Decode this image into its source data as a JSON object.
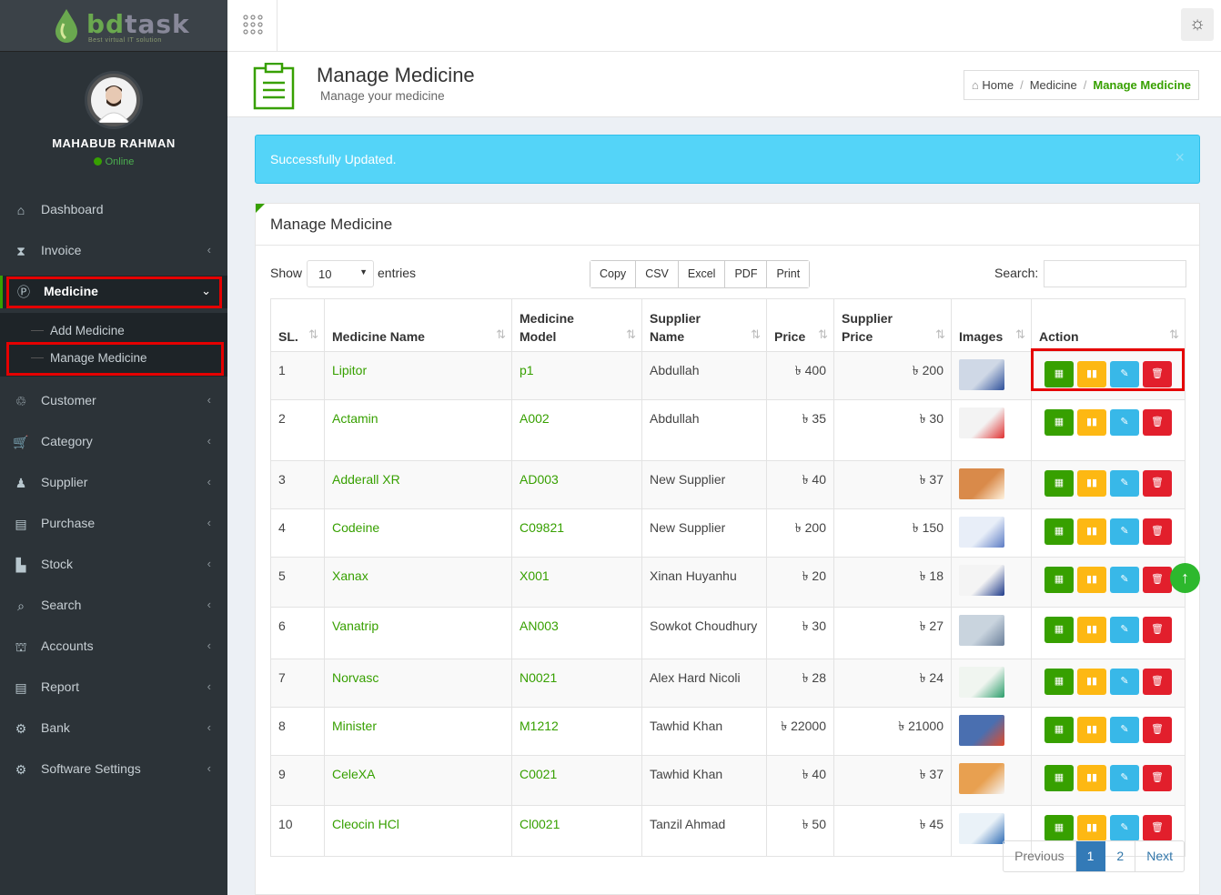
{
  "brand": {
    "name": "bd",
    "name2": "task",
    "tagline": "Best virtual IT solution"
  },
  "user": {
    "name": "MAHABUB RAHMAN",
    "status": "Online"
  },
  "sidebar": {
    "items": [
      {
        "label": "Dashboard",
        "icon": "home-icon",
        "chevron": ""
      },
      {
        "label": "Invoice",
        "icon": "hourglass-icon",
        "chevron": "‹"
      },
      {
        "label": "Medicine",
        "icon": "pill-icon",
        "chevron": "⌄"
      },
      {
        "label": "Customer",
        "icon": "handshake-icon",
        "chevron": "‹"
      },
      {
        "label": "Category",
        "icon": "cart-icon",
        "chevron": "‹"
      },
      {
        "label": "Supplier",
        "icon": "person-icon",
        "chevron": "‹"
      },
      {
        "label": "Purchase",
        "icon": "file-icon",
        "chevron": "‹"
      },
      {
        "label": "Stock",
        "icon": "bar-chart-icon",
        "chevron": "‹"
      },
      {
        "label": "Search",
        "icon": "search-icon",
        "chevron": "‹"
      },
      {
        "label": "Accounts",
        "icon": "bank-icon",
        "chevron": "‹"
      },
      {
        "label": "Report",
        "icon": "report-icon",
        "chevron": "‹"
      },
      {
        "label": "Bank",
        "icon": "gear-icon",
        "chevron": "‹"
      },
      {
        "label": "Software Settings",
        "icon": "gears-icon",
        "chevron": "‹"
      }
    ],
    "sub": [
      "Add Medicine",
      "Manage Medicine"
    ]
  },
  "header": {
    "title": "Manage Medicine",
    "subtitle": "Manage your medicine"
  },
  "breadcrumb": [
    "Home",
    "Medicine",
    "Manage Medicine"
  ],
  "alert": "Successfully Updated.",
  "panel": {
    "title": "Manage Medicine",
    "show": "Show",
    "entries": "entries",
    "page_size": "10",
    "search_label": "Search:",
    "buttons": [
      "Copy",
      "CSV",
      "Excel",
      "PDF",
      "Print"
    ]
  },
  "table": {
    "columns": [
      "SL.",
      "Medicine Name",
      "Medicine Model",
      "Supplier Name",
      "Price",
      "Supplier Price",
      "Images",
      "Action"
    ],
    "rows": [
      {
        "sl": "1",
        "name": "Lipitor",
        "model": "p1",
        "supplier": "Abdullah",
        "price": "৳ 400",
        "sprice": "৳ 200"
      },
      {
        "sl": "2",
        "name": "Actamin",
        "model": "A002",
        "supplier": "Abdullah",
        "price": "৳ 35",
        "sprice": "৳ 30"
      },
      {
        "sl": "3",
        "name": "Adderall XR",
        "model": "AD003",
        "supplier": "New Supplier",
        "price": "৳ 40",
        "sprice": "৳ 37"
      },
      {
        "sl": "4",
        "name": "Codeine",
        "model": "C09821",
        "supplier": "New Supplier",
        "price": "৳ 200",
        "sprice": "৳ 150"
      },
      {
        "sl": "5",
        "name": "Xanax",
        "model": "X001",
        "supplier": "Xinan Huyanhu",
        "price": "৳ 20",
        "sprice": "৳ 18"
      },
      {
        "sl": "6",
        "name": "Vanatrip",
        "model": "AN003",
        "supplier": "Sowkot Choudhury",
        "price": "৳ 30",
        "sprice": "৳ 27"
      },
      {
        "sl": "7",
        "name": "Norvasc",
        "model": "N0021",
        "supplier": "Alex Hard Nicoli",
        "price": "৳ 28",
        "sprice": "৳ 24"
      },
      {
        "sl": "8",
        "name": "Minister",
        "model": "M1212",
        "supplier": "Tawhid Khan",
        "price": "৳ 22000",
        "sprice": "৳ 21000"
      },
      {
        "sl": "9",
        "name": "CeleXA",
        "model": "C0021",
        "supplier": "Tawhid Khan",
        "price": "৳ 40",
        "sprice": "৳ 37"
      },
      {
        "sl": "10",
        "name": "Cleocin HCl",
        "model": "Cl0021",
        "supplier": "Tanzil Ahmad",
        "price": "৳ 50",
        "sprice": "৳ 45"
      }
    ]
  },
  "pagination": {
    "prev": "Previous",
    "pages": [
      "1",
      "2"
    ],
    "next": "Next"
  },
  "colors": {
    "accent": "#37a000",
    "alert": "#54d4f8",
    "highlight": "#e50000"
  }
}
